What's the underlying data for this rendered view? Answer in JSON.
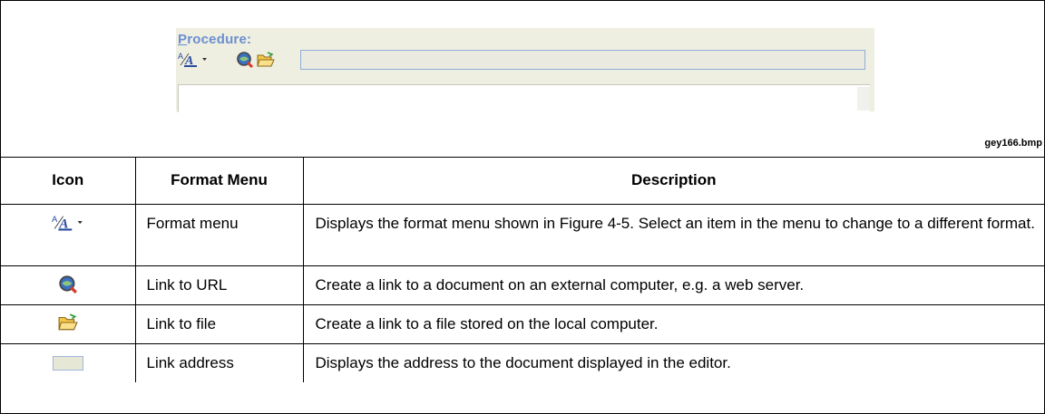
{
  "figure": {
    "procedure_label_first": "P",
    "procedure_label_rest": "rocedure:",
    "address_value": "",
    "caption": "gey166.bmp"
  },
  "table": {
    "headers": {
      "icon": "Icon",
      "menu": "Format Menu",
      "description": "Description"
    },
    "rows": [
      {
        "icon": "format-icon",
        "menu": "Format menu",
        "description": "Displays the format menu shown in Figure 4-5. Select an item in the menu to change to a different format."
      },
      {
        "icon": "link-url-icon",
        "menu": "Link to URL",
        "description": "Create a link to a document on an external computer, e.g. a web server."
      },
      {
        "icon": "open-folder-icon",
        "menu": "Link to file",
        "description": "Create a link to a file stored on the local computer."
      },
      {
        "icon": "link-address-icon",
        "menu": "Link address",
        "description": "Displays the address to the document displayed in the editor."
      }
    ]
  },
  "colors": {
    "label_blue": "#6b8fd0",
    "toolbar_bg": "#eeeee1",
    "icon_red": "#d63a2a",
    "folder_yellow": "#f3c64a"
  }
}
